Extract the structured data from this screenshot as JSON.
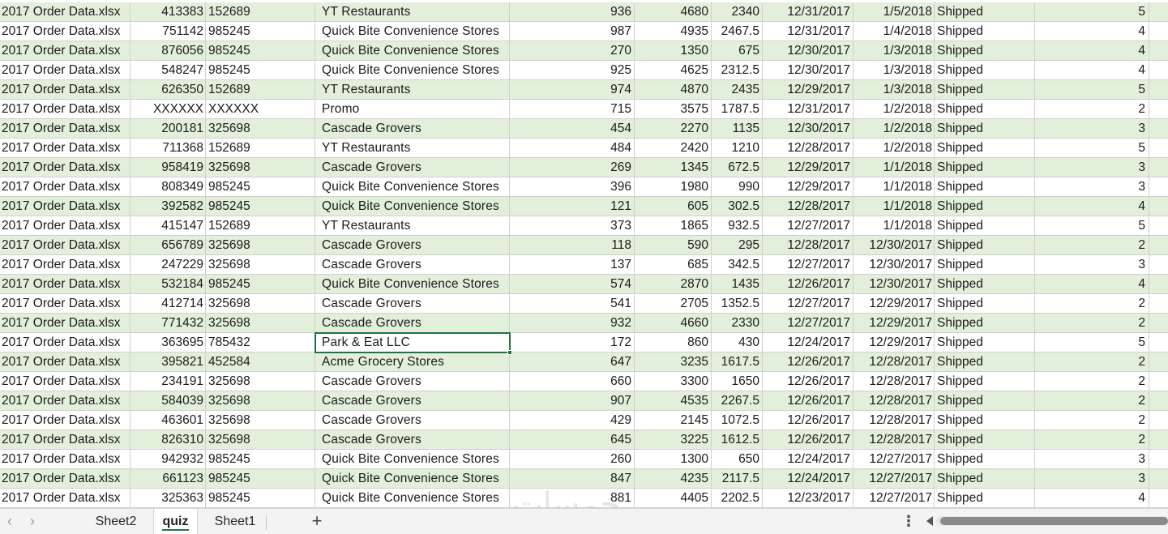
{
  "rows": [
    [
      "2017 Order Data.xlsx",
      "413383",
      "152689",
      "YT Restaurants",
      "936",
      "4680",
      "2340",
      "12/31/2017",
      "1/5/2018",
      "Shipped",
      "5"
    ],
    [
      "2017 Order Data.xlsx",
      "751142",
      "985245",
      "Quick Bite Convenience Stores",
      "987",
      "4935",
      "2467.5",
      "12/31/2017",
      "1/4/2018",
      "Shipped",
      "4"
    ],
    [
      "2017 Order Data.xlsx",
      "876056",
      "985245",
      "Quick Bite Convenience Stores",
      "270",
      "1350",
      "675",
      "12/30/2017",
      "1/3/2018",
      "Shipped",
      "4"
    ],
    [
      "2017 Order Data.xlsx",
      "548247",
      "985245",
      "Quick Bite Convenience Stores",
      "925",
      "4625",
      "2312.5",
      "12/30/2017",
      "1/3/2018",
      "Shipped",
      "4"
    ],
    [
      "2017 Order Data.xlsx",
      "626350",
      "152689",
      "YT Restaurants",
      "974",
      "4870",
      "2435",
      "12/29/2017",
      "1/3/2018",
      "Shipped",
      "5"
    ],
    [
      "2017 Order Data.xlsx",
      "XXXXXX",
      "XXXXXX",
      "Promo",
      "715",
      "3575",
      "1787.5",
      "12/31/2017",
      "1/2/2018",
      "Shipped",
      "2"
    ],
    [
      "2017 Order Data.xlsx",
      "200181",
      "325698",
      "Cascade Grovers",
      "454",
      "2270",
      "1135",
      "12/30/2017",
      "1/2/2018",
      "Shipped",
      "3"
    ],
    [
      "2017 Order Data.xlsx",
      "711368",
      "152689",
      "YT Restaurants",
      "484",
      "2420",
      "1210",
      "12/28/2017",
      "1/2/2018",
      "Shipped",
      "5"
    ],
    [
      "2017 Order Data.xlsx",
      "958419",
      "325698",
      "Cascade Grovers",
      "269",
      "1345",
      "672.5",
      "12/29/2017",
      "1/1/2018",
      "Shipped",
      "3"
    ],
    [
      "2017 Order Data.xlsx",
      "808349",
      "985245",
      "Quick Bite Convenience Stores",
      "396",
      "1980",
      "990",
      "12/29/2017",
      "1/1/2018",
      "Shipped",
      "3"
    ],
    [
      "2017 Order Data.xlsx",
      "392582",
      "985245",
      "Quick Bite Convenience Stores",
      "121",
      "605",
      "302.5",
      "12/28/2017",
      "1/1/2018",
      "Shipped",
      "4"
    ],
    [
      "2017 Order Data.xlsx",
      "415147",
      "152689",
      "YT Restaurants",
      "373",
      "1865",
      "932.5",
      "12/27/2017",
      "1/1/2018",
      "Shipped",
      "5"
    ],
    [
      "2017 Order Data.xlsx",
      "656789",
      "325698",
      "Cascade Grovers",
      "118",
      "590",
      "295",
      "12/28/2017",
      "12/30/2017",
      "Shipped",
      "2"
    ],
    [
      "2017 Order Data.xlsx",
      "247229",
      "325698",
      "Cascade Grovers",
      "137",
      "685",
      "342.5",
      "12/27/2017",
      "12/30/2017",
      "Shipped",
      "3"
    ],
    [
      "2017 Order Data.xlsx",
      "532184",
      "985245",
      "Quick Bite Convenience Stores",
      "574",
      "2870",
      "1435",
      "12/26/2017",
      "12/30/2017",
      "Shipped",
      "4"
    ],
    [
      "2017 Order Data.xlsx",
      "412714",
      "325698",
      "Cascade Grovers",
      "541",
      "2705",
      "1352.5",
      "12/27/2017",
      "12/29/2017",
      "Shipped",
      "2"
    ],
    [
      "2017 Order Data.xlsx",
      "771432",
      "325698",
      "Cascade Grovers",
      "932",
      "4660",
      "2330",
      "12/27/2017",
      "12/29/2017",
      "Shipped",
      "2"
    ],
    [
      "2017 Order Data.xlsx",
      "363695",
      "785432",
      "Park & Eat LLC",
      "172",
      "860",
      "430",
      "12/24/2017",
      "12/29/2017",
      "Shipped",
      "5"
    ],
    [
      "2017 Order Data.xlsx",
      "395821",
      "452584",
      "Acme Grocery Stores",
      "647",
      "3235",
      "1617.5",
      "12/26/2017",
      "12/28/2017",
      "Shipped",
      "2"
    ],
    [
      "2017 Order Data.xlsx",
      "234191",
      "325698",
      "Cascade Grovers",
      "660",
      "3300",
      "1650",
      "12/26/2017",
      "12/28/2017",
      "Shipped",
      "2"
    ],
    [
      "2017 Order Data.xlsx",
      "584039",
      "325698",
      "Cascade Grovers",
      "907",
      "4535",
      "2267.5",
      "12/26/2017",
      "12/28/2017",
      "Shipped",
      "2"
    ],
    [
      "2017 Order Data.xlsx",
      "463601",
      "325698",
      "Cascade Grovers",
      "429",
      "2145",
      "1072.5",
      "12/26/2017",
      "12/28/2017",
      "Shipped",
      "2"
    ],
    [
      "2017 Order Data.xlsx",
      "826310",
      "325698",
      "Cascade Grovers",
      "645",
      "3225",
      "1612.5",
      "12/26/2017",
      "12/28/2017",
      "Shipped",
      "2"
    ],
    [
      "2017 Order Data.xlsx",
      "942932",
      "985245",
      "Quick Bite Convenience Stores",
      "260",
      "1300",
      "650",
      "12/24/2017",
      "12/27/2017",
      "Shipped",
      "3"
    ],
    [
      "2017 Order Data.xlsx",
      "661123",
      "985245",
      "Quick Bite Convenience Stores",
      "847",
      "4235",
      "2117.5",
      "12/24/2017",
      "12/27/2017",
      "Shipped",
      "3"
    ],
    [
      "2017 Order Data.xlsx",
      "325363",
      "985245",
      "Quick Bite Convenience Stores",
      "881",
      "4405",
      "2202.5",
      "12/23/2017",
      "12/27/2017",
      "Shipped",
      "4"
    ]
  ],
  "active_cell": {
    "row": 17,
    "col": 3
  },
  "sheet_tabs": {
    "prev_icon": "‹",
    "next_icon": "›",
    "tabs": [
      {
        "label": "Sheet2",
        "active": false
      },
      {
        "label": "quiz",
        "active": true
      },
      {
        "label": "Sheet1",
        "active": false
      }
    ],
    "add_icon": "+",
    "more_icon": "⋮"
  },
  "watermark": "خمسات",
  "colors": {
    "band": "#e2efda",
    "accent": "#217346",
    "grid": "#d0d0d0"
  }
}
